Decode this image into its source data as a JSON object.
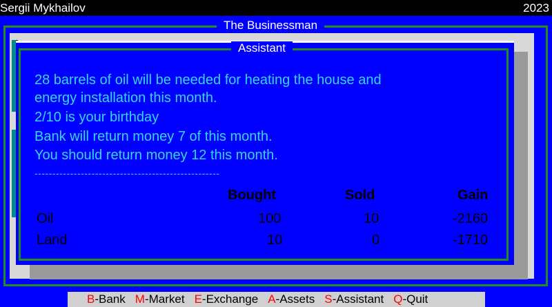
{
  "topbar": {
    "author": "Sergii Mykhailov",
    "year": "2023"
  },
  "main_window": {
    "title": "The Businessman"
  },
  "assistant": {
    "title": "Assistant",
    "messages": [
      "28 barrels of oil will be needed for heating the house and",
      "energy installation this month.",
      "2/10 is your birthday",
      "Bank will return money 7 of this month.",
      "You should return money 12 this month.",
      "----------------------------------------------------"
    ],
    "table": {
      "headers": [
        "Bought",
        "Sold",
        "Gain"
      ],
      "rows": [
        {
          "label": "Oil",
          "bought": "100",
          "sold": "10",
          "gain": "-2160"
        },
        {
          "label": "Land",
          "bought": "10",
          "sold": "0",
          "gain": "-1710"
        }
      ]
    }
  },
  "menu": [
    {
      "key": "B",
      "label": "-Bank"
    },
    {
      "key": "M",
      "label": "-Market"
    },
    {
      "key": "E",
      "label": "-Exchange"
    },
    {
      "key": "A",
      "label": "-Assets"
    },
    {
      "key": "S",
      "label": "-Assistant"
    },
    {
      "key": "Q",
      "label": "-Quit"
    }
  ],
  "colors": {
    "background": "#0000ff",
    "text_cyan": "#36d6e6",
    "frame_green": "#1f8f1f",
    "hotkey": "#ff0000",
    "menu_bg": "#d0d0d0"
  }
}
